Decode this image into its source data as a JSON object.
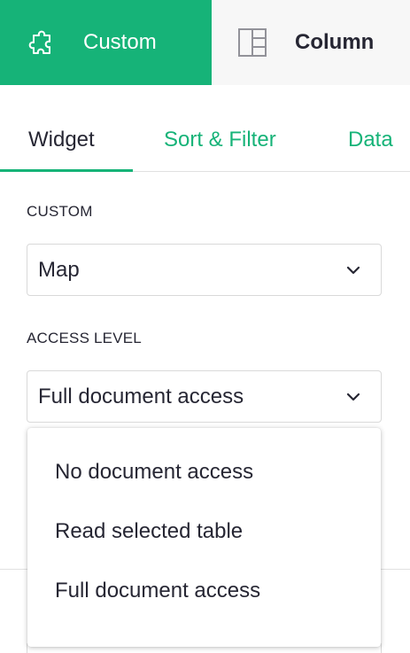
{
  "top_tabs": {
    "custom": {
      "label": "Custom",
      "icon": "puzzle-icon"
    },
    "column": {
      "label": "Column",
      "icon": "column-layout-icon"
    }
  },
  "sub_tabs": {
    "widget": "Widget",
    "sort_filter": "Sort & Filter",
    "data": "Data"
  },
  "custom_section": {
    "label": "CUSTOM",
    "value": "Map"
  },
  "access_section": {
    "label": "ACCESS LEVEL",
    "value": "Full document access"
  },
  "access_menu": {
    "options": [
      "No document access",
      "Read selected table",
      "Full document access"
    ]
  },
  "colors": {
    "accent": "#16b378",
    "text": "#262633",
    "tab_bg": "#f7f7f7"
  }
}
